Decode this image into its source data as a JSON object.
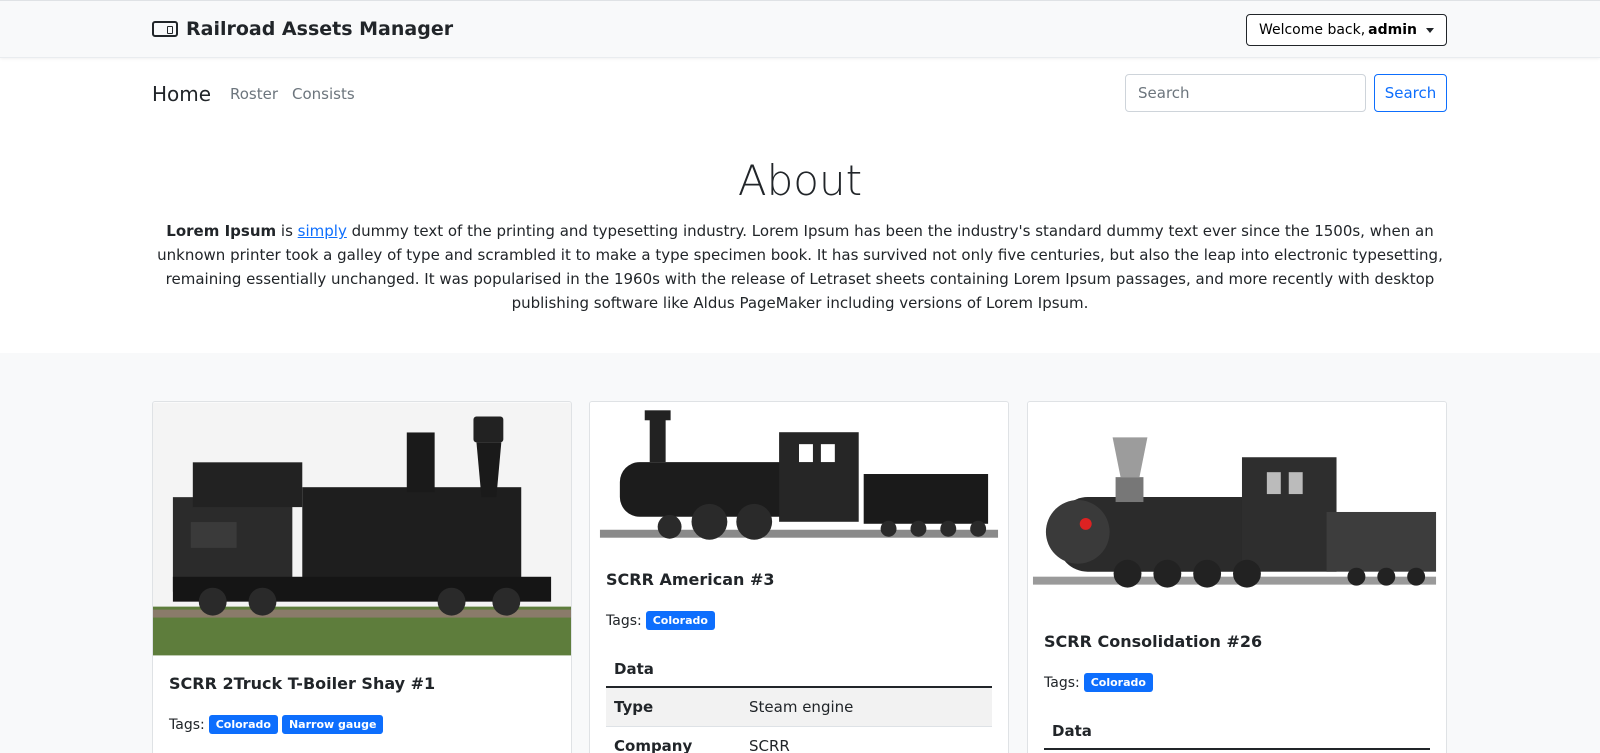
{
  "header": {
    "brand": "Railroad Assets Manager",
    "welcome": "Welcome back, ",
    "user": "admin"
  },
  "nav": {
    "home": "Home",
    "roster": "Roster",
    "consists": "Consists"
  },
  "search": {
    "placeholder": "Search",
    "button": "Search"
  },
  "about": {
    "title": "About",
    "lead_bold": "Lorem Ipsum",
    "is": " is ",
    "link": "simply",
    "rest": " dummy text of the printing and typesetting industry. Lorem Ipsum has been the industry's standard dummy text ever since the 1500s, when an unknown printer took a galley of type and scrambled it to make a type specimen book. It has survived not only five centuries, but also the leap into electronic typesetting, remaining essentially unchanged. It was popularised in the 1960s with the release of Letraset sheets containing Lorem Ipsum passages, and more recently with desktop publishing software like Aldus PageMaker including versions of Lorem Ipsum."
  },
  "cards": [
    {
      "title": "SCRR 2Truck T-Boiler Shay #1",
      "tags_label": "Tags:",
      "tags": [
        "Colorado",
        "Narrow gauge"
      ]
    },
    {
      "title": "SCRR American #3",
      "tags_label": "Tags:",
      "tags": [
        "Colorado"
      ],
      "table_header": "Data",
      "rows": [
        {
          "key": "Type",
          "value": "Steam engine"
        },
        {
          "key": "Company",
          "value": "SCRR"
        }
      ]
    },
    {
      "title": "SCRR Consolidation #26",
      "tags_label": "Tags:",
      "tags": [
        "Colorado"
      ],
      "table_header": "Data"
    }
  ]
}
